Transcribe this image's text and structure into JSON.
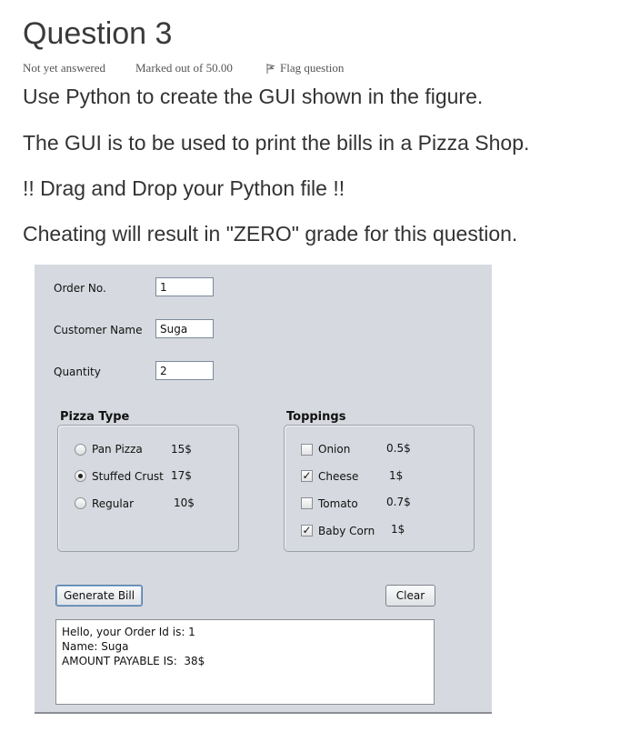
{
  "question": {
    "title": "Question 3",
    "status": "Not yet answered",
    "marks": "Marked out of 50.00",
    "flag_label": "Flag question",
    "paragraphs": [
      "Use Python to create the GUI shown in the figure.",
      "The GUI is to be used to print the bills in a Pizza Shop.",
      "!! Drag and Drop your Python file !!",
      "Cheating will result in \"ZERO\" grade for this question."
    ]
  },
  "gui": {
    "fields": {
      "order_label": "Order No.",
      "order_value": "1",
      "customer_label": "Customer Name",
      "customer_value": "Suga",
      "quantity_label": "Quantity",
      "quantity_value": "2"
    },
    "pizza_type": {
      "title": "Pizza Type",
      "options": [
        {
          "label": "Pan Pizza",
          "price": "15$",
          "selected": false
        },
        {
          "label": "Stuffed Crust",
          "price": "17$",
          "selected": true
        },
        {
          "label": "Regular",
          "price": "10$",
          "selected": false
        }
      ]
    },
    "toppings": {
      "title": "Toppings",
      "options": [
        {
          "label": "Onion",
          "price": "0.5$",
          "checked": false
        },
        {
          "label": "Cheese",
          "price": "1$",
          "checked": true
        },
        {
          "label": "Tomato",
          "price": "0.7$",
          "checked": false
        },
        {
          "label": "Baby Corn",
          "price": "1$",
          "checked": true
        }
      ]
    },
    "buttons": {
      "generate": "Generate Bill",
      "clear": "Clear"
    },
    "output_lines": [
      "Hello, your Order Id is: 1",
      "Name: Suga",
      "AMOUNT PAYABLE IS:  38$"
    ]
  }
}
